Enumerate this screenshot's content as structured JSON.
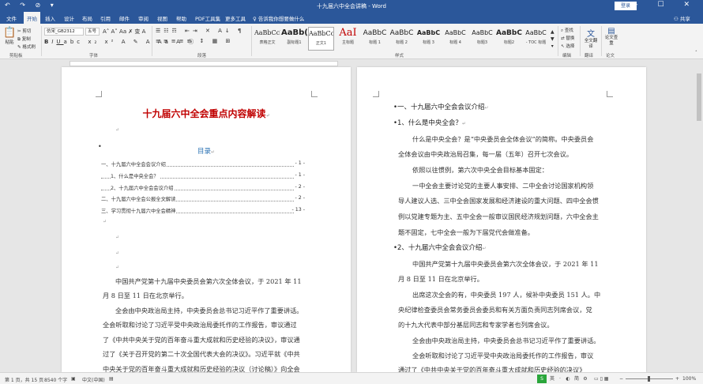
{
  "titlebar": {
    "title": "十九届六中全会讲稿 - Word",
    "login": "登录",
    "quick_access": "↶ ↷ ⊘ ▾",
    "window_buttons": "— ☐ ✕"
  },
  "tabs": [
    "文件",
    "开始",
    "插入",
    "设计",
    "布局",
    "引用",
    "邮件",
    "审阅",
    "视图",
    "帮助",
    "PDF工具集",
    "更多工具"
  ],
  "tell_me": "告诉我你想要做什么",
  "share": "共享",
  "ribbon": {
    "paste": "粘贴",
    "cut": "剪切",
    "copy": "复制",
    "format_painter": "格式刷",
    "clipboard_label": "剪贴板",
    "font_name": "仿宋_GB2312",
    "font_size": "五号",
    "font_label": "字体",
    "paragraph_label": "段落",
    "styles_label": "样式",
    "styles": [
      {
        "sample": "AaBbCcI",
        "name": "表格正文"
      },
      {
        "sample": "AaBb(",
        "name": "副标题1"
      },
      {
        "sample": "AaBbCc",
        "name": "正文1"
      },
      {
        "sample": "AaI",
        "name": "主标题"
      },
      {
        "sample": "AaBbC",
        "name": "标题 1"
      },
      {
        "sample": "AaBbC",
        "name": "标题 2"
      },
      {
        "sample": "AaBbC",
        "name": "标题 3"
      },
      {
        "sample": "AaBbC",
        "name": "标题 4"
      },
      {
        "sample": "AaBbC",
        "name": "标题3"
      },
      {
        "sample": "AaBbC",
        "name": "标题2"
      },
      {
        "sample": "AaBbC",
        "name": "- TOC 标题"
      },
      {
        "sample": "AaBbC",
        "name": "标题 1"
      }
    ],
    "find": "查找",
    "replace": "替换",
    "select": "选择",
    "editing_label": "编辑",
    "translate": "全文翻译",
    "translate_label": "翻译",
    "paper_check": "论文查重",
    "paper_label": "论文"
  },
  "page1": {
    "title": "十九届六中全会重点内容解读",
    "toc_heading": "目录",
    "toc": [
      {
        "text": "一、十九届六中全会会议介绍",
        "page": "- 1 -"
      },
      {
        "text": "1、什么是中央全会？",
        "page": "- 1 -"
      },
      {
        "text": "2、十九届六中全会会议介绍",
        "page": "- 2 -"
      },
      {
        "text": "二、十九届六中全会公报全文解读",
        "page": "- 2 -"
      },
      {
        "text": "三、学习贯彻十九届六中全会精神",
        "page": "- 13 -"
      }
    ],
    "para1_l1": "中国共产党第十九届中央委员会第六次全体会议，于 2021 年 11",
    "para1_l2": "月 8 日至 11 日在北京举行。",
    "para2_l1": "全会由中央政治局主持，中央委员会总书记习近平作了重要讲话。",
    "para2_l2": "全会听取和讨论了习近平受中央政治局委托作的工作报告，审议通过",
    "para2_l3": "了《中共中央关于党的百年奋斗重大成就和历史经验的决议》，审议通",
    "para2_l4": "过了《关于召开党的第二十次全国代表大会的决议》。习近平就《中共",
    "para2_l5": "中央关于党的百年奋斗重大成就和历史经验的决议（讨论稿）》向全会"
  },
  "page2": {
    "h1": "一、十九届六中全会会议介绍",
    "h2a": "1、什么是中央全会？",
    "lines": [
      "什么是中央全会？是“中央委员会全体会议”的简称。中央委员会",
      "全体会议由中央政治局召集，每一届（五年）召开七次会议。",
      "依照以往惯例，第六次中央全会目标基本固定：",
      "一中全会主要讨论党的主要人事安排、二中全会讨论国家机构领",
      "导人建议人选、三中全会国家发展和经济建设的重大问题、四中全会惯",
      "例以党建专题为主、五中全会一般审议国民经济规划问题，六中全会主",
      "题不固定，七中全会一般为下届党代会做准备。"
    ],
    "h2b": "2、十九届六中全会会议介绍",
    "lines2": [
      "中国共产党第十九届中央委员会第六次全体会议，于 2021 年 11",
      "月 8 日至 11 日在北京举行。",
      "出席这次全会的有，中央委员 197 人，候补中央委员 151 人。中",
      "央纪律检查委员会常务委员会委员和有关方面负责同志列席会议，党",
      "的十九大代表中部分基层同志和专家学者也列席会议。",
      "全会由中央政治局主持，中央委员会总书记习近平作了重要讲话。",
      "全会听取和讨论了习近平受中央政治局委托作的工作报告，审议",
      "通过了《中共中央关于党的百年奋斗重大成就和历史经验的决议》"
    ]
  },
  "status": {
    "page": "第 1 页，共 15 页",
    "words": "8540 个字",
    "lang": "中文(中国)",
    "zoom": "100%",
    "ime": [
      "英",
      "·",
      "◐",
      "简",
      "⚙"
    ]
  }
}
